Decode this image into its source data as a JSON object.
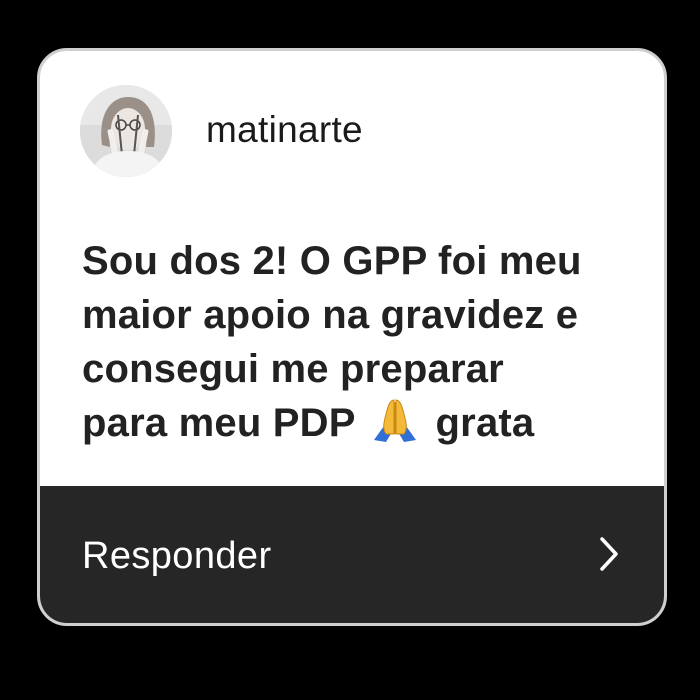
{
  "card": {
    "username": "matinarte",
    "avatar_icon": "user-avatar-photo",
    "message": {
      "lines": [
        "Sou dos 2! O GPP foi meu",
        "maior apoio na gravidez e",
        "consegui me preparar",
        "para meu PDP"
      ],
      "emoji_icon": "folded-hands-emoji",
      "suffix": "grata"
    },
    "reply": {
      "label": "Responder",
      "icon": "chevron-right-icon"
    }
  },
  "colors": {
    "background": "#000000",
    "card": "#ffffff",
    "reply_bar": "#262626",
    "text": "#222222"
  }
}
